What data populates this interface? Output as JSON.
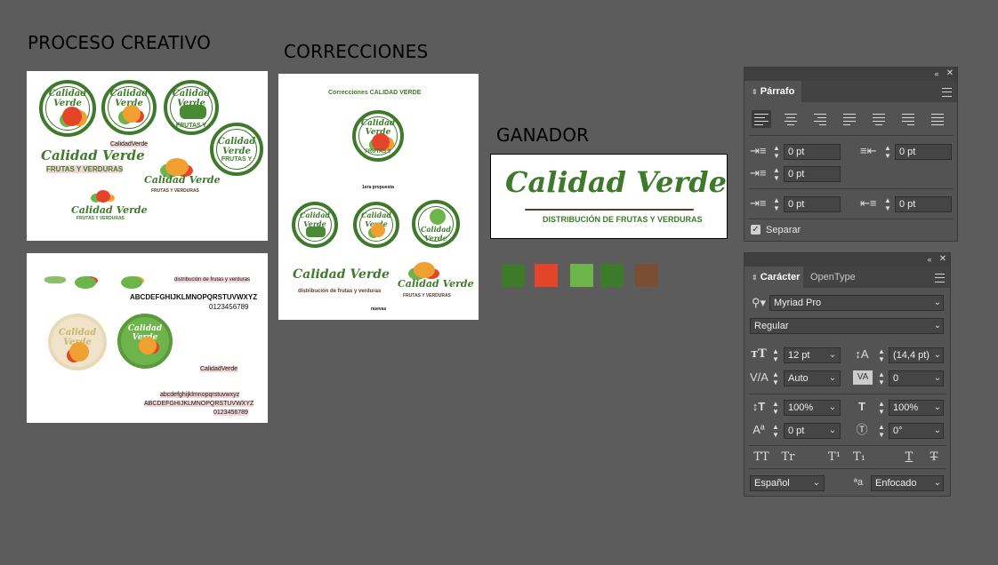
{
  "headings": {
    "proceso": "PROCESO CREATIVO",
    "correcciones": "CORRECCIONES",
    "ganador": "GANADOR"
  },
  "artboard1": {
    "badge_text": "Calidad Verde",
    "frutas_y": "FRUTAS Y",
    "label_small": "CalidadVerde",
    "wordmark": "Calidad Verde",
    "wordmark_sub": "FRUTAS Y VERDURAS",
    "frutas_y_verduras": "FRUTAS Y VERDURAS",
    "frutas_y_verduras_small": "FRUTAS Y VERDURAS"
  },
  "artboard2": {
    "dist_text": "distribución de frutas y verduras",
    "upper_alphabet": "ABCDEFGHIJKLMNOPQRSTUVWXYZ",
    "digits": "0123456789",
    "label_small": "CalidadVerde",
    "lower_alphabet": "abcdefghijklmnopqrstuvwxyz",
    "upper_alphabet2": "ABCDEFGHIJKLMNOPQRSTUVWXYZ",
    "digits2": "0123456789",
    "badge_text": "Calidad Verde"
  },
  "artboard3": {
    "title": "Correcciones CALIDAD VERDE",
    "badge_text": "Calidad Verde",
    "frutas_y": "FRUTAS Y",
    "propuesta": "1era propuesta",
    "wordmark": "Calidad Verde",
    "dist_text": "distribución de frutas y verduras",
    "frutas_y_verduras": "FRUTAS Y VERDURAS",
    "nuevas": "nuevas"
  },
  "winner": {
    "wordmark": "Calidad Verde",
    "tagline": "DISTRIBUCIÓN DE FRUTAS Y VERDURAS"
  },
  "swatches": [
    "#3d7a2a",
    "#e4452a",
    "#6db44a",
    "#3d7a2a",
    "#7a4e32"
  ],
  "parrafo": {
    "tab": "Párrafo",
    "left_indent": "0 pt",
    "right_indent": "0 pt",
    "first_line": "0 pt",
    "space_before": "0 pt",
    "space_after": "0 pt",
    "separar_label": "Separar"
  },
  "caracter": {
    "tab_caracter": "Carácter",
    "tab_opentype": "OpenType",
    "font_family": "Myriad Pro",
    "font_style": "Regular",
    "font_size": "12 pt",
    "leading": "(14,4 pt)",
    "kerning": "Auto",
    "tracking": "0",
    "vscale": "100%",
    "hscale": "100%",
    "baseline": "0 pt",
    "rotation": "0°",
    "language": "Español",
    "antialias": "Enfocado",
    "tt_caps": "TT",
    "tt_smallcaps": "Tr",
    "tt_super": "T¹",
    "tt_sub": "T₁",
    "tt_underline": "T",
    "tt_strike": "T"
  }
}
